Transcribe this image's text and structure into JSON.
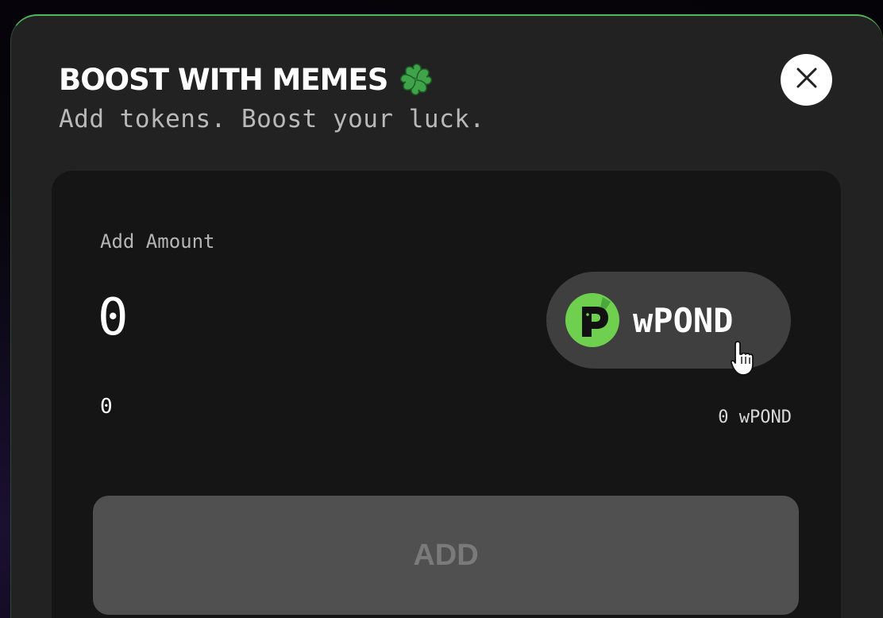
{
  "modal": {
    "title": "BOOST WITH MEMES",
    "subtitle": "Add tokens. Boost your luck.",
    "title_icon": "four-leaf-clover-icon",
    "close_icon": "close-icon",
    "accent_color": "#4fb85a"
  },
  "form": {
    "amount_label": "Add Amount",
    "amount_value": "0",
    "usd_value": "0",
    "token": {
      "symbol": "wPOND",
      "icon": "wpond-token-icon",
      "icon_color": "#6fcf4f"
    },
    "balance": "0 wPOND",
    "submit_label": "ADD"
  }
}
